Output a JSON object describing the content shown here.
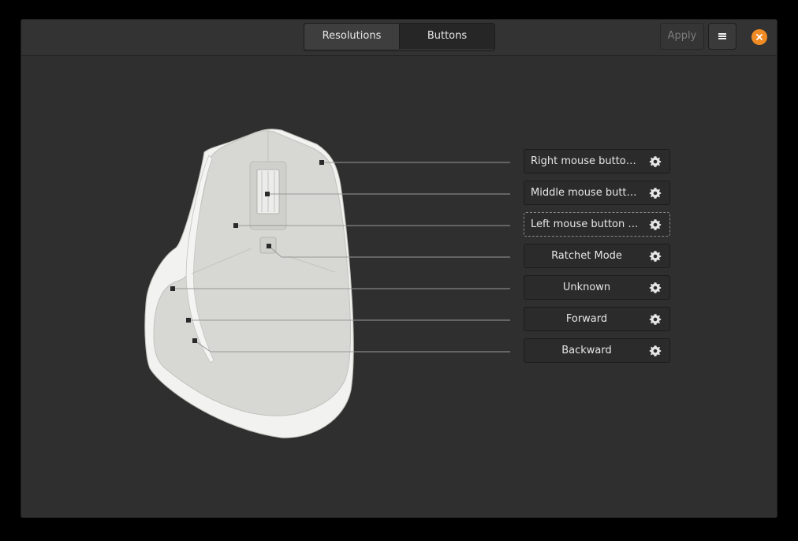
{
  "header": {
    "tabs": [
      {
        "label": "Resolutions",
        "selected": false
      },
      {
        "label": "Buttons",
        "selected": true
      }
    ],
    "apply_label": "Apply",
    "menu_icon": "hamburger-icon",
    "close_icon": "close-icon"
  },
  "buttons": [
    {
      "label": "Right mouse button …",
      "icon": "gear-icon"
    },
    {
      "label": "Middle mouse butto…",
      "icon": "gear-icon"
    },
    {
      "label": "Left mouse button cli…",
      "icon": "gear-icon",
      "focused": true
    },
    {
      "label": "Ratchet Mode",
      "icon": "gear-icon"
    },
    {
      "label": "Unknown",
      "icon": "gear-icon"
    },
    {
      "label": "Forward",
      "icon": "gear-icon"
    },
    {
      "label": "Backward",
      "icon": "gear-icon"
    }
  ],
  "colors": {
    "window_bg": "#2f2f2f",
    "close_accent": "#f08a24",
    "mouse_body": "#d7d7d3",
    "mouse_edge": "#f2f2f0"
  }
}
